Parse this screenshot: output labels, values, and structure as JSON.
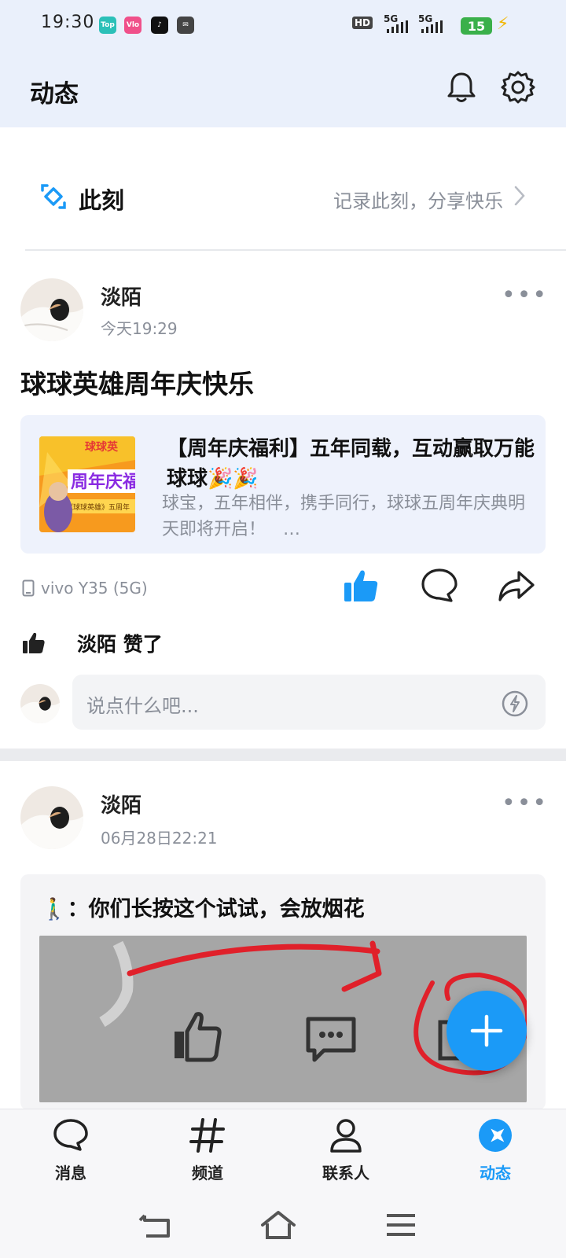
{
  "colors": {
    "accent": "#1b9af7",
    "header_bg": "#eaf0fb",
    "battery": "#3ab04a",
    "annotation": "#e0202a"
  },
  "status_bar": {
    "time": "19:30",
    "app_icons": [
      "top-app-icon",
      "vlog-app-icon",
      "tiktok-app-icon",
      "message-app-icon"
    ],
    "hd_label": "HD",
    "hd_sub": "1 2",
    "network": [
      "5G",
      "5G"
    ],
    "battery": "15"
  },
  "header": {
    "title": "动态"
  },
  "moment": {
    "label": "此刻",
    "hint": "记录此刻，分享快乐"
  },
  "post1": {
    "author": "淡陌",
    "time": "今天19:29",
    "text": "球球英雄周年庆快乐",
    "share": {
      "title": "【周年庆福利】五年同载，互动赢取万能球球🎉🎉",
      "desc": "球宝，五年相伴，携手同行，球球五周年庆典明天即将开启！　…",
      "thumb_banner": "周年庆福",
      "thumb_top": "球球英",
      "thumb_sub": "《球球英雄》五周年"
    },
    "device": "vivo Y35 (5G)",
    "like_text": "淡陌 赞了",
    "comment_placeholder": "说点什么吧..."
  },
  "post2": {
    "author": "淡陌",
    "time": "06月28日22:21",
    "text": "🚶‍♂️：你们长按这个试试，会放烟花"
  },
  "nav": {
    "tabs": [
      {
        "label": "消息"
      },
      {
        "label": "频道"
      },
      {
        "label": "联系人"
      },
      {
        "label": "动态"
      }
    ],
    "active": "动态"
  }
}
